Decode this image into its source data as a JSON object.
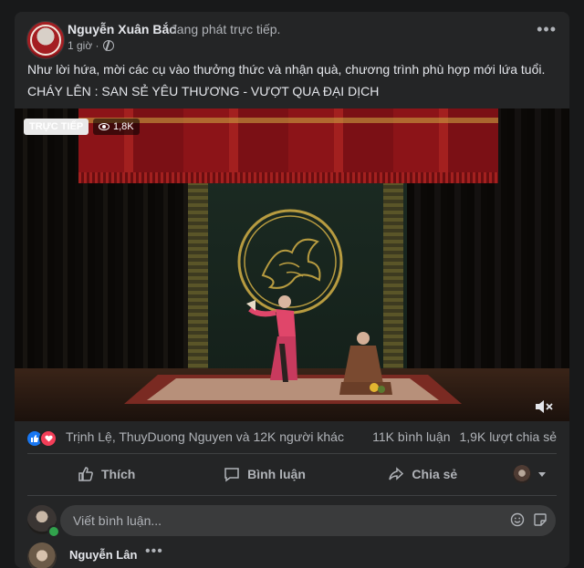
{
  "post": {
    "author": "Nguyễn Xuân Bắc",
    "action": "đang phát trực tiếp.",
    "time": "1 giờ ·",
    "caption_line1": "Như lời hứa, mời các cụ vào thưởng thức và nhận quà, chương trình phù hợp mới lứa tuổi.",
    "caption_line2": "CHÁY LÊN : SAN SẺ YÊU THƯƠNG - VƯỢT QUA ĐẠI DỊCH",
    "more_icon": "more-horizontal-icon",
    "privacy_icon": "globe-icon"
  },
  "video": {
    "live_label": "TRỰC TIẾP",
    "viewers": "1,8K",
    "mute_icon": "volume-muted-icon"
  },
  "engagement": {
    "reaction_names": "Trịnh Lệ, ThuyDuong Nguyen và 12K người khác",
    "comments": "11K bình luận",
    "shares": "1,9K lượt chia sẻ",
    "reaction_icons": [
      "like-icon",
      "love-icon"
    ]
  },
  "actions": {
    "like": "Thích",
    "comment": "Bình luận",
    "share": "Chia sẻ"
  },
  "comment_input": {
    "placeholder": "Viết bình luận..."
  },
  "first_comment": {
    "author": "Nguyễn Lân"
  },
  "colors": {
    "background": "#18191a",
    "card": "#242526",
    "text_primary": "#e4e6eb",
    "text_secondary": "#b0b3b8",
    "like_blue": "#1877f2",
    "love_red": "#f33e58"
  }
}
